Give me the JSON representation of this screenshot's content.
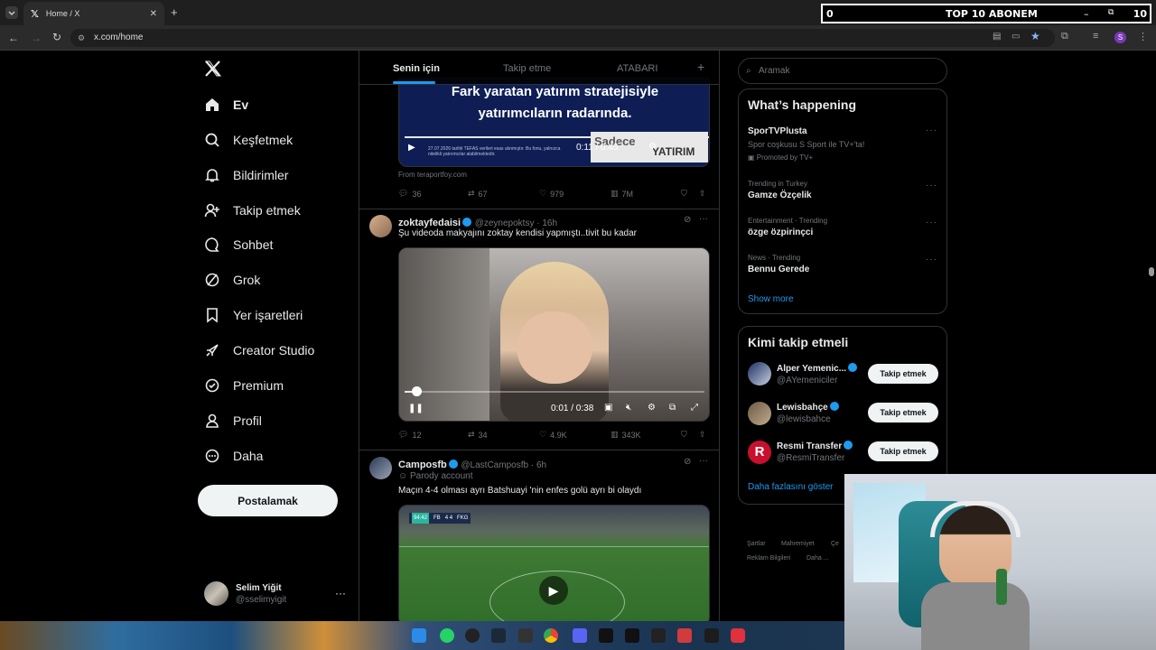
{
  "browser": {
    "tab_title": "Home / X",
    "url": "x.com/home"
  },
  "overlay": {
    "left_value": "0",
    "title": "TOP 10 ABONEM",
    "right_value": "10"
  },
  "nav": {
    "items": [
      {
        "label": "Ev",
        "icon": "home-icon"
      },
      {
        "label": "Keşfetmek",
        "icon": "search-icon"
      },
      {
        "label": "Bildirimler",
        "icon": "bell-icon"
      },
      {
        "label": "Takip etmek",
        "icon": "person-add-icon"
      },
      {
        "label": "Sohbet",
        "icon": "chat-icon"
      },
      {
        "label": "Grok",
        "icon": "grok-icon"
      },
      {
        "label": "Yer işaretleri",
        "icon": "bookmark-icon"
      },
      {
        "label": "Creator Studio",
        "icon": "rocket-icon"
      },
      {
        "label": "Premium",
        "icon": "premium-icon"
      },
      {
        "label": "Profil",
        "icon": "profile-icon"
      },
      {
        "label": "Daha",
        "icon": "more-circle-icon"
      }
    ],
    "post_label": "Postalamak",
    "account": {
      "name": "Selim Yiğit",
      "handle": "@sselimyigit"
    }
  },
  "feed": {
    "tabs": [
      "Senin için",
      "Takip etme",
      "ATABARI"
    ],
    "tweet1": {
      "ad_line1": "Fark yaratan yatırım stratejisiyle",
      "ad_line2": "yatırımcıların radarında.",
      "ad_small": "27.07.2026 tarihli TEFAS verileri esas alınmıştır. Bu fonu, yalnızca nitelikli yatırımcılar alabilmektedir.",
      "ad_brand": "Sadece",
      "ad_brand2": "YATIRIM",
      "video_time": "0:11 / 0:45",
      "from": "From teraportfoy.com",
      "replies": "36",
      "reposts": "67",
      "likes": "979",
      "views": "7M"
    },
    "tweet2": {
      "name": "zoktayfedaisi",
      "handle": "@zeynepoktsy",
      "time": "16h",
      "text": "Şu videoda makyajını zoktay kendisi yapmıştı..tivit bu kadar",
      "video_time": "0:01 / 0:38",
      "progress": 0.04,
      "replies": "12",
      "reposts": "34",
      "likes": "4.9K",
      "views": "343K"
    },
    "tweet3": {
      "name": "Camposfb",
      "handle": "@LastCamposfb",
      "time": "6h",
      "parody": "Parody account",
      "text": "Maçın 4-4 olması ayrı Batshuayi 'nin enfes golü ayrı bi olaydı",
      "score_home": "FB",
      "score": "4 4",
      "score_away": "FKG",
      "clock": "94:42"
    }
  },
  "right": {
    "search_placeholder": "Aramak",
    "whats_happening": "What’s happening",
    "trends": [
      {
        "meta": "",
        "name": "SporTVPlusta",
        "desc": "Spor coşkusu S Sport ile TV+'ta!",
        "promo": "Promoted by TV+"
      },
      {
        "meta": "Trending in Turkey",
        "name": "Gamze Özçelik"
      },
      {
        "meta": "Entertainment · Trending",
        "name": "özge özpirinçci"
      },
      {
        "meta": "News · Trending",
        "name": "Bennu Gerede"
      }
    ],
    "show_more": "Show more",
    "who_to_follow": "Kimi takip etmeli",
    "follow": [
      {
        "name": "Alper Yemenic...",
        "handle": "@AYemeniciler"
      },
      {
        "name": "Lewisbahçe",
        "handle": "@lewisbahce"
      },
      {
        "name": "Resmi Transfer",
        "handle": "@ResmiTransfer"
      }
    ],
    "follow_label": "Takip etmek",
    "show_more_follow": "Daha fazlasını göster",
    "footer": [
      "Şartlar",
      "Mahremiyet",
      "Çe",
      "Reklam Bilgileri",
      "Daha ..."
    ]
  },
  "colors": {
    "accent": "#1d9bf0",
    "background": "#000000",
    "border": "#2f3336"
  }
}
